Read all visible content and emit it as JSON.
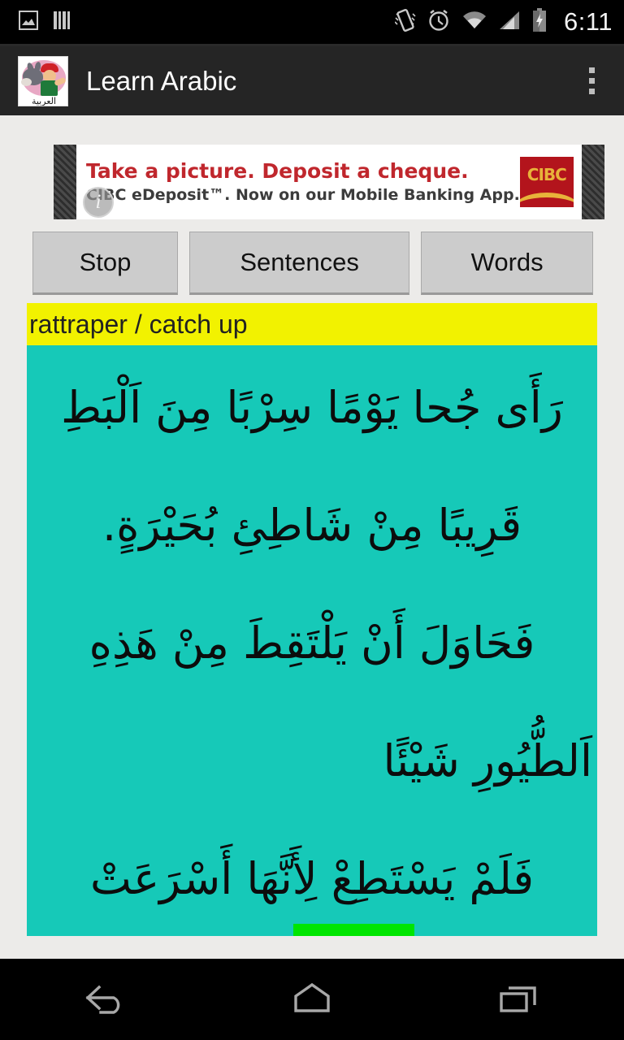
{
  "status_bar": {
    "time": "6:11",
    "left_icons": [
      "photo-icon",
      "barcode-icon"
    ],
    "right_icons": [
      "vibrate-icon",
      "alarm-icon",
      "wifi-icon",
      "signal-icon",
      "battery-charging-icon"
    ]
  },
  "app_bar": {
    "title": "Learn Arabic",
    "icon_caption": "العربية",
    "overflow_label": "More options"
  },
  "ad": {
    "headline": "Take a picture. Deposit a cheque.",
    "subline": "CIBC eDeposit™. Now on our Mobile Banking App.",
    "brand": "CIBC",
    "info_glyph": "i"
  },
  "buttons": {
    "stop": "Stop",
    "sentences": "Sentences",
    "words": "Words"
  },
  "translation": {
    "text": "rattraper / catch up"
  },
  "arabic": {
    "lines": [
      {
        "text": "رَأَى جُحا يَوْمًا سِرْبًا مِنَ اَلْبَطِ",
        "align": "center"
      },
      {
        "text": "قَرِيبًا مِنْ شَاطِئِ بُحَيْرَةٍ.",
        "align": "center"
      },
      {
        "text": "فَحَاوَلَ أَنْ يَلْتَقِطَ مِنْ هَذِهِ",
        "align": "center"
      },
      {
        "text": "اَلطُّيُورِ شَيْئًا",
        "align": "right"
      },
      {
        "text": "فَلَمْ يَسْتَطِعْ لِأَنَّهَا أَسْرَعَتْ",
        "align": "center"
      }
    ],
    "highlighted_word": "يَلْتَقِطَ"
  },
  "nav_bar": {
    "back": "back-icon",
    "home": "home-icon",
    "recents": "recents-icon"
  },
  "colors": {
    "teal_panel": "#16c9b8",
    "highlight_yellow": "#f2f200",
    "highlight_green": "#00e500",
    "appbar": "#252525",
    "page_bg": "#ecebe9",
    "ad_red": "#c0272d",
    "cibc_red": "#b3141c",
    "cibc_gold": "#e8b33a"
  }
}
